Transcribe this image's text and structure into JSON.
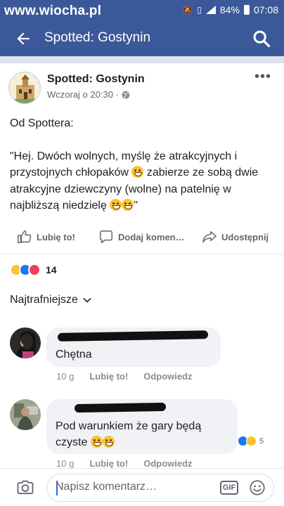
{
  "statusbar": {
    "watermark": "www.wiocha.pl",
    "battery": "84%",
    "time": "07:08",
    "icons": [
      "mute-icon",
      "vibrate-icon",
      "signal-icon",
      "battery-icon"
    ]
  },
  "appbar": {
    "title": "Spotted: Gostynin",
    "back_icon": "arrow-left-icon",
    "search_icon": "search-icon",
    "bg_color": "#3b5998"
  },
  "post": {
    "page_name": "Spotted: Gostynin",
    "time": "Wczoraj o 20:30 ·",
    "privacy_icon": "globe-icon",
    "more_icon": "more-icon",
    "line1": "Od Spottera:",
    "quote_part1": "\"Hej. Dwóch wolnych, myślę że atrakcyjnych i przystojnych chłopaków",
    "quote_part2": " zabierze ze sobą dwie atrakcyjne dziewczyny (wolne) na patelnię w najbliższą niedzielę",
    "quote_end": "\""
  },
  "actions": {
    "like": "Lubię to!",
    "comment": "Dodaj komen…",
    "share": "Udostępnij"
  },
  "reactions": {
    "types": [
      "haha",
      "like",
      "love"
    ],
    "count": "14"
  },
  "comments_filter": "Najtrafniejsze",
  "comments": [
    {
      "text": "Chętna",
      "time": "10 g",
      "like": "Lubię to!",
      "reply": "Odpowiedz"
    },
    {
      "text": "Pod warunkiem że gary będą czyste",
      "time": "10 g",
      "like": "Lubię to!",
      "reply": "Odpowiedz",
      "reaction_count": "5"
    }
  ],
  "composer": {
    "placeholder": "Napisz komentarz…",
    "gif": "GIF"
  }
}
